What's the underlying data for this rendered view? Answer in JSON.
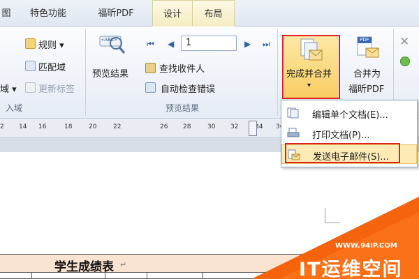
{
  "tabs": [
    "图",
    "特色功能",
    "福昕PDF",
    "设计",
    "布局"
  ],
  "ribbon": {
    "rules_label": "规则 ▾",
    "match_fields_label": "匹配域",
    "field_cut_label": "域 ▾",
    "update_labels_label": "更新标签",
    "insert_fields_group": "入域",
    "preview_results_label": "预览结果",
    "abc_badge": "«ABC»",
    "record_value": "1",
    "find_recipient_label": "查找收件人",
    "auto_check_errors_label": "自动检查错误",
    "preview_group_label": "预览结果",
    "finish_merge_label": "完成并合并",
    "merge_pdf_label_1": "合并为",
    "merge_pdf_label_2": "福昕PDF",
    "pdf_badge": "PDF",
    "dropdown_arrow": "▾"
  },
  "ruler": {
    "ticks": [
      "2",
      "14",
      "16",
      "18",
      "20",
      "22",
      "26",
      "28",
      "30",
      "32",
      "34",
      "36"
    ]
  },
  "menu": {
    "items": [
      "编辑单个文档(E)...",
      "打印文档(P)...",
      "发送电子邮件(S)..."
    ]
  },
  "document": {
    "table_title": "学生成绩表",
    "paragraph_mark": "↵"
  },
  "watermark": {
    "url": "WWW.94IP.COM",
    "brand": "IT运维空间"
  },
  "colors": {
    "highlight": "#e02121",
    "accent_orange": "#f5640c",
    "table_header_bg": "#fbe3d2",
    "active_tab_bg": "#f4ecc1",
    "menu_selected_bg": "#fdebb5"
  }
}
